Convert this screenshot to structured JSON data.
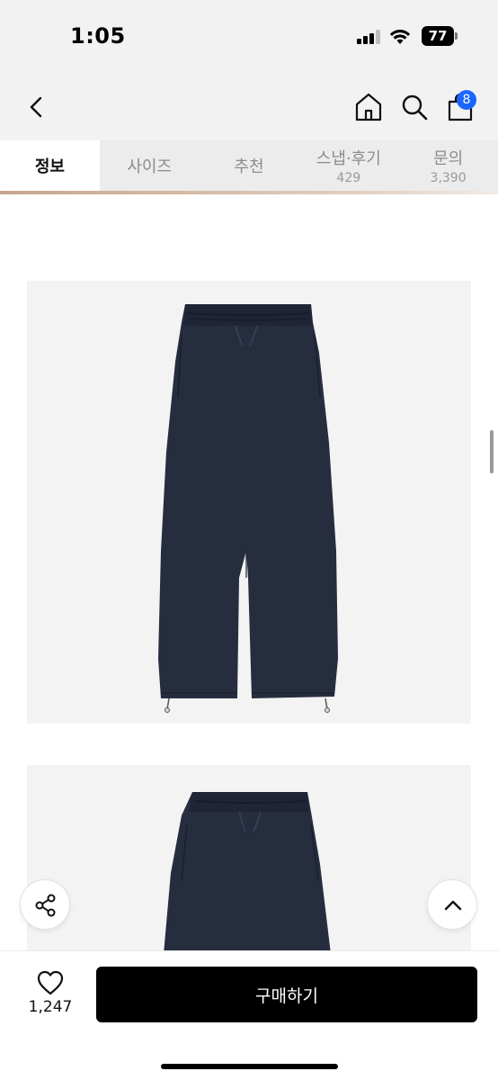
{
  "status_bar": {
    "time": "1:05",
    "battery": "77"
  },
  "nav": {
    "back_icon": "chevron-left-icon",
    "home_icon": "home-icon",
    "search_icon": "search-icon",
    "bag_icon": "shopping-bag-icon",
    "bag_badge": "8",
    "badge_color": "#1a66ff"
  },
  "tabs": [
    {
      "label": "정보",
      "count": ""
    },
    {
      "label": "사이즈",
      "count": ""
    },
    {
      "label": "추천",
      "count": ""
    },
    {
      "label": "스냅·후기",
      "count": "429"
    },
    {
      "label": "문의",
      "count": "3,390"
    }
  ],
  "content": {
    "image_1": "navy-sweatpants-image",
    "image_2": "navy-sweatpants-image"
  },
  "floating": {
    "share_icon": "share-icon",
    "scroll_top_icon": "chevron-up-icon"
  },
  "bottom_bar": {
    "like_icon": "heart-icon",
    "like_count": "1,247",
    "buy_label": "구매하기"
  }
}
